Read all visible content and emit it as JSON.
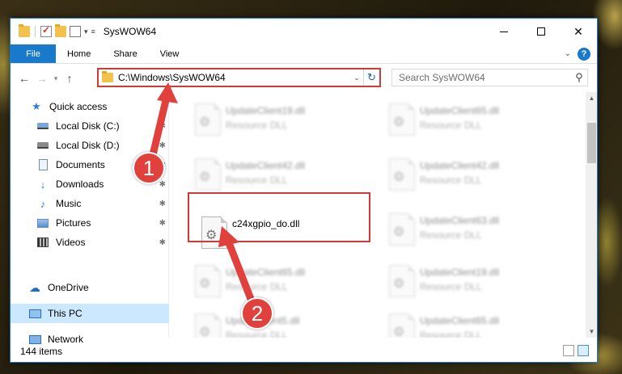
{
  "window": {
    "title": "SysWOW64"
  },
  "ribbon": {
    "tabs": [
      {
        "label": "File"
      },
      {
        "label": "Home"
      },
      {
        "label": "Share"
      },
      {
        "label": "View"
      }
    ],
    "help": "?"
  },
  "address": {
    "path": "C:\\Windows\\SysWOW64",
    "search_placeholder": "Search SysWOW64"
  },
  "nav": {
    "items": [
      {
        "label": "Quick access",
        "icon": "star-icon"
      },
      {
        "label": "Local Disk (C:)",
        "icon": "disk-icon"
      },
      {
        "label": "Local Disk (D:)",
        "icon": "disk-icon"
      },
      {
        "label": "Documents",
        "icon": "document-icon"
      },
      {
        "label": "Downloads",
        "icon": "download-icon"
      },
      {
        "label": "Music",
        "icon": "music-icon"
      },
      {
        "label": "Pictures",
        "icon": "pictures-icon"
      },
      {
        "label": "Videos",
        "icon": "videos-icon"
      },
      {
        "label": "OneDrive",
        "icon": "cloud-icon"
      },
      {
        "label": "This PC",
        "icon": "computer-icon"
      },
      {
        "label": "Network",
        "icon": "network-icon"
      }
    ]
  },
  "files": [
    {
      "name": "UpdateClient19.dll",
      "type": "Resource DLL"
    },
    {
      "name": "UpdateClient65.dll",
      "type": "Resource DLL"
    },
    {
      "name": "UpdateClient42.dll",
      "type": "Resource DLL"
    },
    {
      "name": "UpdateClient42.dll",
      "type": "Resource DLL"
    },
    {
      "name": "c24xgpio_do.dll",
      "type": ""
    },
    {
      "name": "UpdateClient63.dll",
      "type": "Resource DLL"
    },
    {
      "name": "UpdateClient65.dll",
      "type": "Resource DLL"
    },
    {
      "name": "UpdateClient19.dll",
      "type": "Resource DLL"
    },
    {
      "name": "UpdateClient5.dll",
      "type": "Resource DLL"
    },
    {
      "name": "UpdateClient65.dll",
      "type": "Resource DLL"
    }
  ],
  "status": {
    "item_count": "144 items"
  },
  "callouts": {
    "one": "1",
    "two": "2"
  },
  "colors": {
    "accent": "#1979ca",
    "highlight": "#d23a3a",
    "callout": "#e0413d"
  }
}
